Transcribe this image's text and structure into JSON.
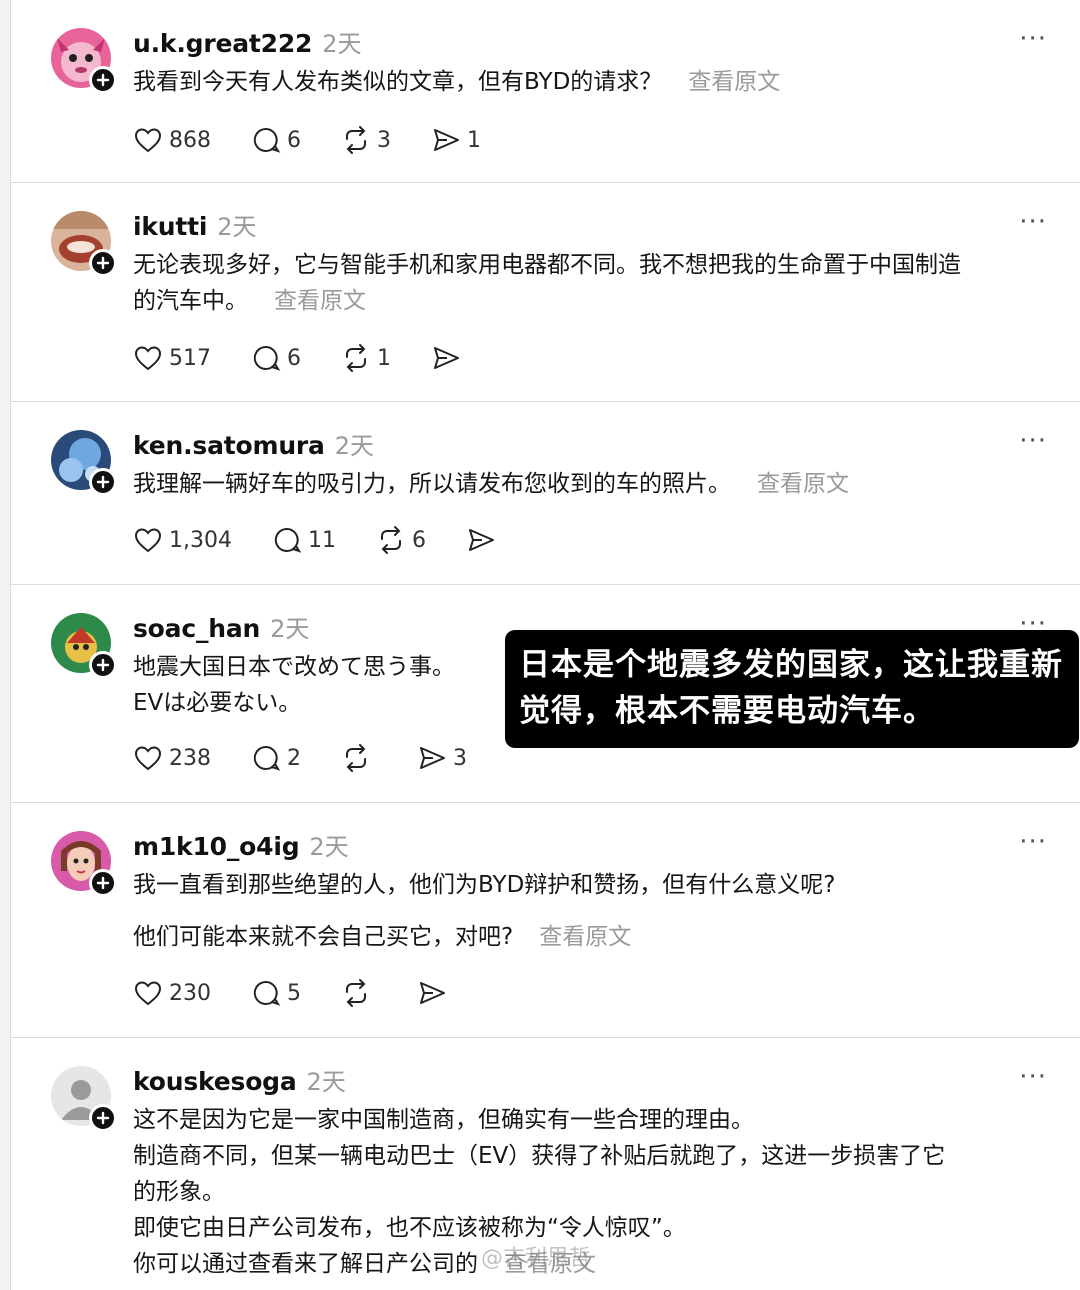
{
  "posts": [
    {
      "username": "u.k.great222",
      "time": "2天",
      "more": "···",
      "lines": [
        "我看到今天有人发布类似的文章，但有BYD的请求？"
      ],
      "view_original": "查看原文",
      "likes": "868",
      "replies": "6",
      "reposts": "3",
      "shares": "1"
    },
    {
      "username": "ikutti",
      "time": "2天",
      "more": "···",
      "lines": [
        "无论表现多好，它与智能手机和家用电器都不同。我不想把我的生命置于中国制造",
        "的汽车中。"
      ],
      "view_original": "查看原文",
      "likes": "517",
      "replies": "6",
      "reposts": "1",
      "shares": ""
    },
    {
      "username": "ken.satomura",
      "time": "2天",
      "more": "···",
      "lines": [
        "我理解一辆好车的吸引力，所以请发布您收到的车的照片。"
      ],
      "view_original": "查看原文",
      "likes": "1,304",
      "replies": "11",
      "reposts": "6",
      "shares": ""
    },
    {
      "username": "soac_han",
      "time": "2天",
      "more": "···",
      "lines": [
        "地震大国日本で改めて思う事。",
        "EVは必要ない。"
      ],
      "view_original": "",
      "likes": "238",
      "replies": "2",
      "reposts": "",
      "shares": "3"
    },
    {
      "username": "m1k10_o4ig",
      "time": "2天",
      "more": "···",
      "lines": [
        "我一直看到那些绝望的人，他们为BYD辩护和赞扬，但有什么意义呢?",
        "他们可能本来就不会自己买它，对吧?"
      ],
      "view_original": "查看原文",
      "likes": "230",
      "replies": "5",
      "reposts": "",
      "shares": ""
    },
    {
      "username": "kouskesoga",
      "time": "2天",
      "more": "···",
      "lines": [
        "这不是因为它是一家中国制造商，但确实有一些合理的理由。",
        "制造商不同，但某一辆电动巴士（EV）获得了补贴后就跑了，这进一步损害了它",
        "的形象。",
        "即使它由日产公司发布，也不应该被称为“令人惊叹”。",
        "你可以通过查看来了解日产公司的"
      ],
      "view_original": "查看原文",
      "likes": "",
      "replies": "",
      "reposts": "",
      "shares": ""
    }
  ],
  "overlay_caption": "日本是个地震多发的国家，这让我重新觉得，根本不需要电动汽车。",
  "watermark": "@吉利思哲",
  "colors": {
    "text": "#111111",
    "muted": "#9a9a9a",
    "divider": "#dcdcdc",
    "overlay_bg": "#000000"
  }
}
